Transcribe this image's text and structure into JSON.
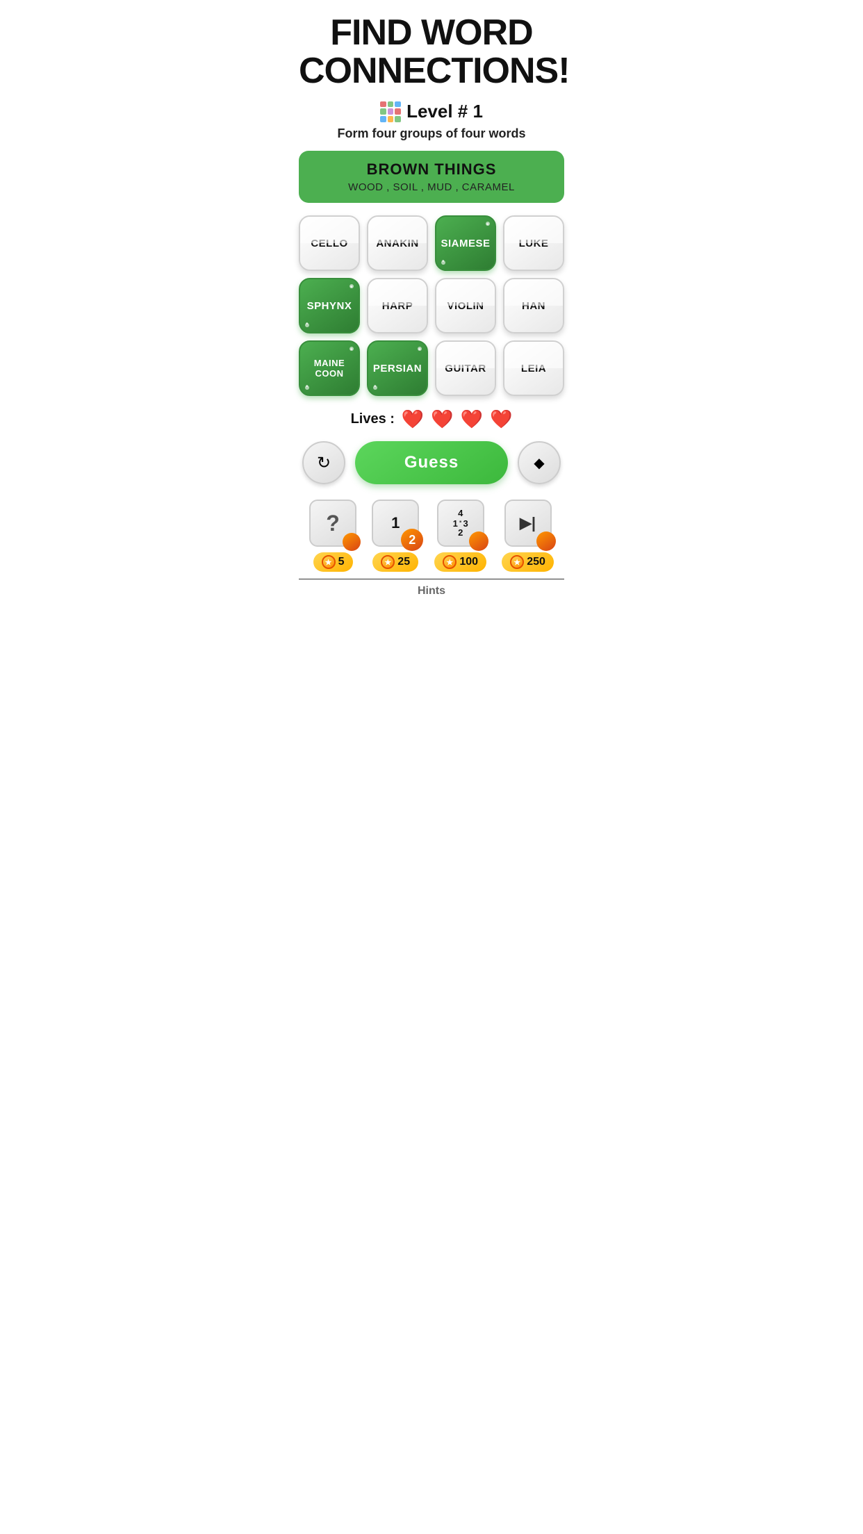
{
  "header": {
    "title_line1": "FIND WORD",
    "title_line2": "CONNECTIONS!",
    "level_icon_alt": "colorful grid icon",
    "level_text": "Level # 1",
    "subtitle": "Form four groups of four words"
  },
  "completed_group": {
    "title": "BROWN THINGS",
    "words": "WOOD , SOIL , MUD , CARAMEL"
  },
  "tiles": [
    {
      "word": "CELLO",
      "selected": false
    },
    {
      "word": "ANAKIN",
      "selected": false
    },
    {
      "word": "SIAMESE",
      "selected": true
    },
    {
      "word": "LUKE",
      "selected": false
    },
    {
      "word": "SPHYNX",
      "selected": true
    },
    {
      "word": "HARP",
      "selected": false
    },
    {
      "word": "VIOLIN",
      "selected": false
    },
    {
      "word": "HAN",
      "selected": false
    },
    {
      "word": "MAINE\nCOON",
      "selected": true
    },
    {
      "word": "PERSIAN",
      "selected": true
    },
    {
      "word": "GUITAR",
      "selected": false
    },
    {
      "word": "LEIA",
      "selected": false
    }
  ],
  "lives": {
    "label": "Lives :",
    "count": 4
  },
  "buttons": {
    "shuffle_label": "↺",
    "guess_label": "Guess",
    "erase_label": "◆"
  },
  "hints": [
    {
      "icon": "?",
      "numbers": null,
      "cost": "5"
    },
    {
      "icon": "12",
      "numbers": null,
      "cost": "25"
    },
    {
      "icon": "123",
      "numbers": null,
      "cost": "100"
    },
    {
      "icon": "▶|",
      "numbers": null,
      "cost": "250"
    }
  ],
  "hints_label": "Hints",
  "colors": {
    "green": "#4caf50",
    "dark_green": "#2e7d32",
    "orange": "#ff9800",
    "gold": "#ffc107",
    "red": "#e53935"
  }
}
